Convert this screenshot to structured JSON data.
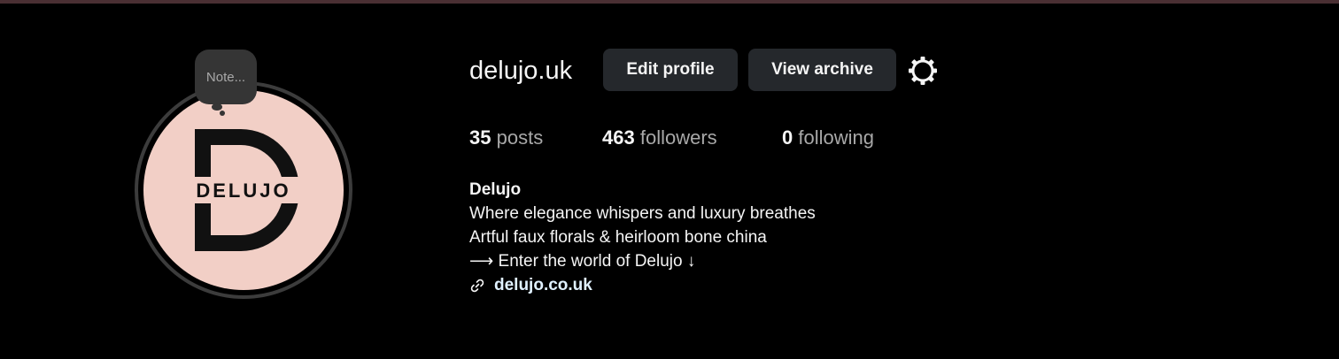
{
  "colors": {
    "background": "#000000",
    "top_bar": "#4a2f33",
    "button_bg": "#25282c",
    "avatar_bg": "#f2cfc6",
    "logo": "#111111"
  },
  "note": {
    "label": "Note..."
  },
  "avatar": {
    "logo_text": "DELUJO"
  },
  "profile": {
    "username": "delujo.uk",
    "edit_profile_label": "Edit profile",
    "view_archive_label": "View archive",
    "settings_icon": "gear-icon"
  },
  "stats": {
    "posts_count": "35",
    "posts_label": "posts",
    "followers_count": "463",
    "followers_label": "followers",
    "following_count": "0",
    "following_label": "following"
  },
  "bio": {
    "name": "Delujo",
    "line1": "Where elegance whispers and luxury breathes",
    "line2": "Artful faux florals & heirloom bone china",
    "line3": "⟶ Enter the world of Delujo ↓",
    "link_icon": "link-icon",
    "link": "delujo.co.uk"
  }
}
